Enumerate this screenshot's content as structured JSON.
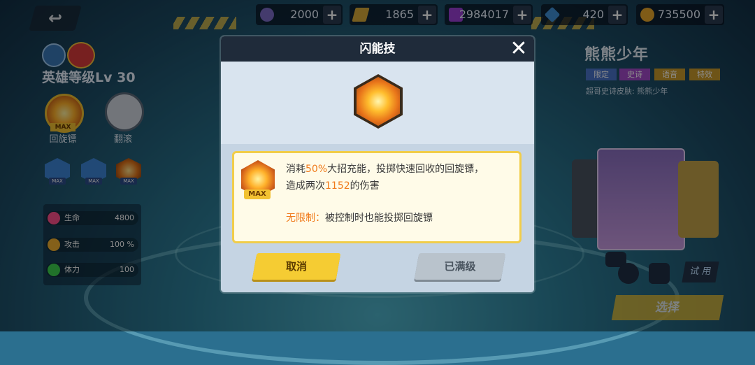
{
  "resources": [
    {
      "name": "energy",
      "value": "2000",
      "color": "#7d6cc6"
    },
    {
      "name": "card",
      "value": "1865",
      "color": "#d7a93a"
    },
    {
      "name": "purple-gem",
      "value": "2984017",
      "color": "#9b3fd6"
    },
    {
      "name": "blue-gem",
      "value": "420",
      "color": "#3f8fd6"
    },
    {
      "name": "gold-coin",
      "value": "735500",
      "color": "#e7a72a"
    }
  ],
  "hero": {
    "level": "英雄等级Lv 30",
    "skills": [
      {
        "label": "回旋镖",
        "max": "MAX"
      },
      {
        "label": "翻滚"
      }
    ],
    "small_max": [
      "MAX",
      "MAX",
      "MAX"
    ],
    "stats": [
      {
        "label": "生命",
        "value": "4800",
        "color": "#ff4f8a"
      },
      {
        "label": "攻击",
        "value": "100 %",
        "color": "#f0b030"
      },
      {
        "label": "体力",
        "value": "100",
        "color": "#3ccf4e"
      }
    ]
  },
  "character": {
    "name": "熊熊少年",
    "tags": [
      {
        "label": "限定",
        "color": "#4a74c8"
      },
      {
        "label": "史诗",
        "color": "#a24ac8"
      },
      {
        "label": "语音",
        "color": "#c89a2a"
      },
      {
        "label": "特效",
        "color": "#c89a2a"
      }
    ],
    "skin_text": "超哥史诗皮肤: 熊熊少年",
    "try_label": "试 用",
    "select_label": "选择"
  },
  "modal": {
    "title": "闪能技",
    "close": "✕",
    "badge_max": "MAX",
    "desc": {
      "line1_pre": "消耗",
      "line1_hl": "50%",
      "line1_post": "大招充能，投掷快速回收的回旋镖，",
      "line2_pre": "造成两次",
      "line2_hl": "1152",
      "line2_post": "的伤害",
      "line3_hl": "无限制：",
      "line3_post": "被控制时也能投掷回旋镖"
    },
    "cancel_label": "取消",
    "full_label": "已满级"
  }
}
